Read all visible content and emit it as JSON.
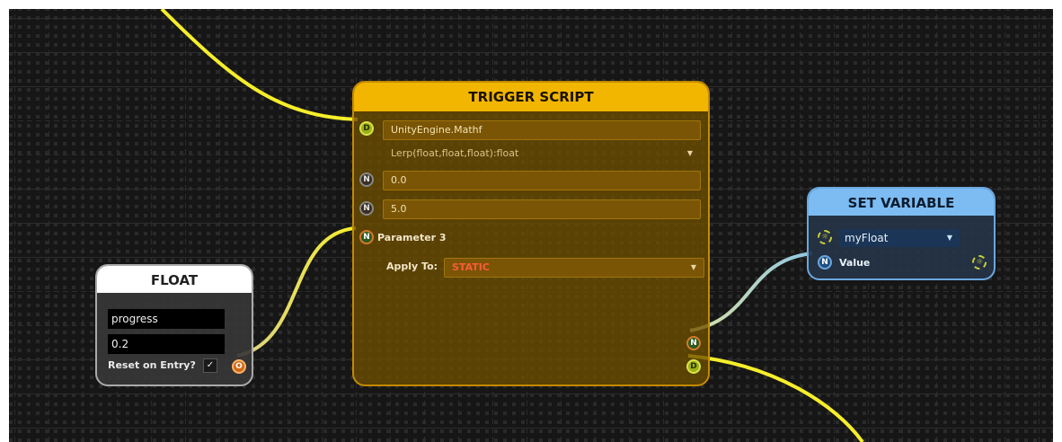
{
  "colors": {
    "canvas_bg": "#161616",
    "wire_yellow": "#f5ee2a",
    "wire_cool": "#8fc6e6",
    "trigger_header": "#f2b600",
    "float_header": "#ffffff",
    "setvar_header": "#7dbcf2",
    "static_text": "#ff5a3a"
  },
  "trigger": {
    "title": "TRIGGER SCRIPT",
    "class_name": "UnityEngine.Mathf",
    "method": "Lerp(float,float,float):float",
    "param1": "0.0",
    "param2": "5.0",
    "param3_label": "Parameter 3",
    "apply_label": "Apply To:",
    "apply_value": "STATIC",
    "socket_d": "D",
    "socket_n": "N"
  },
  "float_node": {
    "title": "FLOAT",
    "name_value": "progress",
    "value": "0.2",
    "reset_label": "Reset on Entry?",
    "reset_checked": "✓",
    "socket_o": "O"
  },
  "setvar": {
    "title": "SET VARIABLE",
    "variable": "myFloat",
    "value_label": "Value",
    "socket_n": "N"
  }
}
